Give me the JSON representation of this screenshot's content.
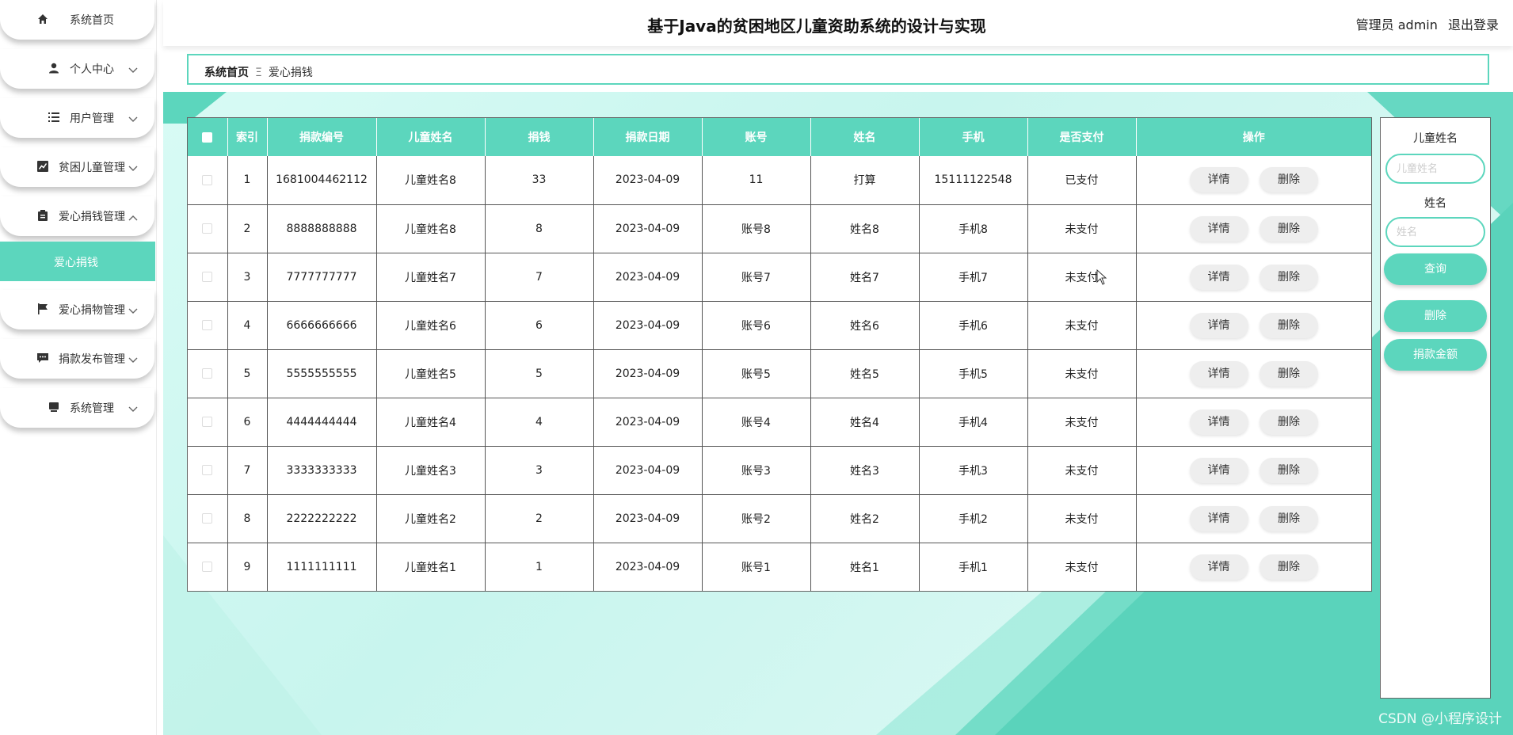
{
  "app": {
    "title": "基于Java的贫困地区儿童资助系统的设计与实现",
    "user_label": "管理员 admin",
    "logout_label": "退出登录"
  },
  "sidebar": {
    "items": [
      {
        "label": "系统首页",
        "icon": "home-icon"
      },
      {
        "label": "个人中心",
        "icon": "user-icon"
      },
      {
        "label": "用户管理",
        "icon": "list-icon"
      },
      {
        "label": "贫困儿童管理",
        "icon": "chart-icon"
      },
      {
        "label": "爱心捐钱管理",
        "icon": "clipboard-icon"
      },
      {
        "label": "爱心捐物管理",
        "icon": "flag-icon"
      },
      {
        "label": "捐款发布管理",
        "icon": "message-icon"
      },
      {
        "label": "系统管理",
        "icon": "monitor-icon"
      }
    ],
    "active_sub": "爱心捐钱"
  },
  "breadcrumb": {
    "home": "系统首页",
    "separator": "Ξ",
    "current": "爱心捐钱"
  },
  "table": {
    "columns": [
      "索引",
      "捐款编号",
      "儿童姓名",
      "捐钱",
      "捐款日期",
      "账号",
      "姓名",
      "手机",
      "是否支付",
      "操作"
    ],
    "action_detail": "详情",
    "action_delete": "删除",
    "rows": [
      {
        "index": "1",
        "code": "1681004462112",
        "child": "儿童姓名8",
        "amount": "33",
        "date": "2023-04-09",
        "account": "11",
        "name": "打算",
        "phone": "15111122548",
        "paid": "已支付"
      },
      {
        "index": "2",
        "code": "8888888888",
        "child": "儿童姓名8",
        "amount": "8",
        "date": "2023-04-09",
        "account": "账号8",
        "name": "姓名8",
        "phone": "手机8",
        "paid": "未支付"
      },
      {
        "index": "3",
        "code": "7777777777",
        "child": "儿童姓名7",
        "amount": "7",
        "date": "2023-04-09",
        "account": "账号7",
        "name": "姓名7",
        "phone": "手机7",
        "paid": "未支付"
      },
      {
        "index": "4",
        "code": "6666666666",
        "child": "儿童姓名6",
        "amount": "6",
        "date": "2023-04-09",
        "account": "账号6",
        "name": "姓名6",
        "phone": "手机6",
        "paid": "未支付"
      },
      {
        "index": "5",
        "code": "5555555555",
        "child": "儿童姓名5",
        "amount": "5",
        "date": "2023-04-09",
        "account": "账号5",
        "name": "姓名5",
        "phone": "手机5",
        "paid": "未支付"
      },
      {
        "index": "6",
        "code": "4444444444",
        "child": "儿童姓名4",
        "amount": "4",
        "date": "2023-04-09",
        "account": "账号4",
        "name": "姓名4",
        "phone": "手机4",
        "paid": "未支付"
      },
      {
        "index": "7",
        "code": "3333333333",
        "child": "儿童姓名3",
        "amount": "3",
        "date": "2023-04-09",
        "account": "账号3",
        "name": "姓名3",
        "phone": "手机3",
        "paid": "未支付"
      },
      {
        "index": "8",
        "code": "2222222222",
        "child": "儿童姓名2",
        "amount": "2",
        "date": "2023-04-09",
        "account": "账号2",
        "name": "姓名2",
        "phone": "手机2",
        "paid": "未支付"
      },
      {
        "index": "9",
        "code": "1111111111",
        "child": "儿童姓名1",
        "amount": "1",
        "date": "2023-04-09",
        "account": "账号1",
        "name": "姓名1",
        "phone": "手机1",
        "paid": "未支付"
      }
    ]
  },
  "search": {
    "child_label": "儿童姓名",
    "child_placeholder": "儿童姓名",
    "child_value": "",
    "name_label": "姓名",
    "name_placeholder": "姓名",
    "name_value": "",
    "query_button": "查询",
    "delete_button": "删除",
    "sum_button": "捐款金额"
  },
  "watermark": "CSDN @小程序设计",
  "colors": {
    "accent": "#5cd6bd",
    "background": "#d8fbf5"
  }
}
